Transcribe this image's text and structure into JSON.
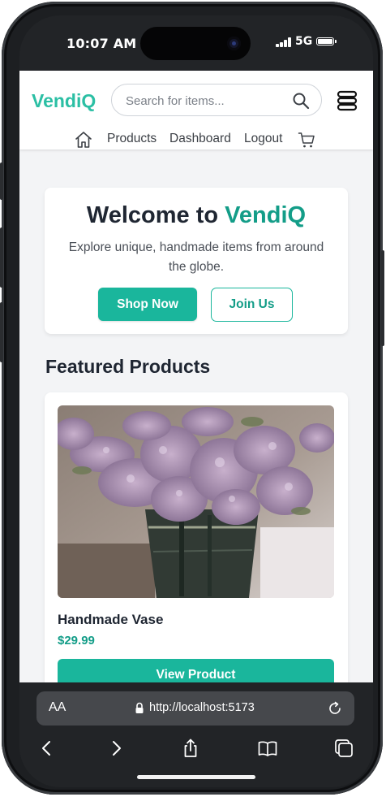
{
  "status_bar": {
    "time": "10:07 AM",
    "network": "5G"
  },
  "app": {
    "logo": "VendiQ",
    "search_placeholder": "Search for items...",
    "nav": {
      "products": "Products",
      "dashboard": "Dashboard",
      "logout": "Logout"
    }
  },
  "hero": {
    "title_prefix": "Welcome to ",
    "title_brand": "VendiQ",
    "subtitle": "Explore unique, handmade items from around the globe.",
    "shop_now": "Shop Now",
    "join_us": "Join Us"
  },
  "featured": {
    "title": "Featured Products",
    "products": [
      {
        "name": "Handmade Vase",
        "price": "$29.99",
        "button": "View Product"
      }
    ]
  },
  "browser": {
    "aa": "AA",
    "url": "http://localhost:5173"
  },
  "colors": {
    "accent": "#1ab69c",
    "brand_dark": "#139d88",
    "logo": "#2bbfa4"
  }
}
